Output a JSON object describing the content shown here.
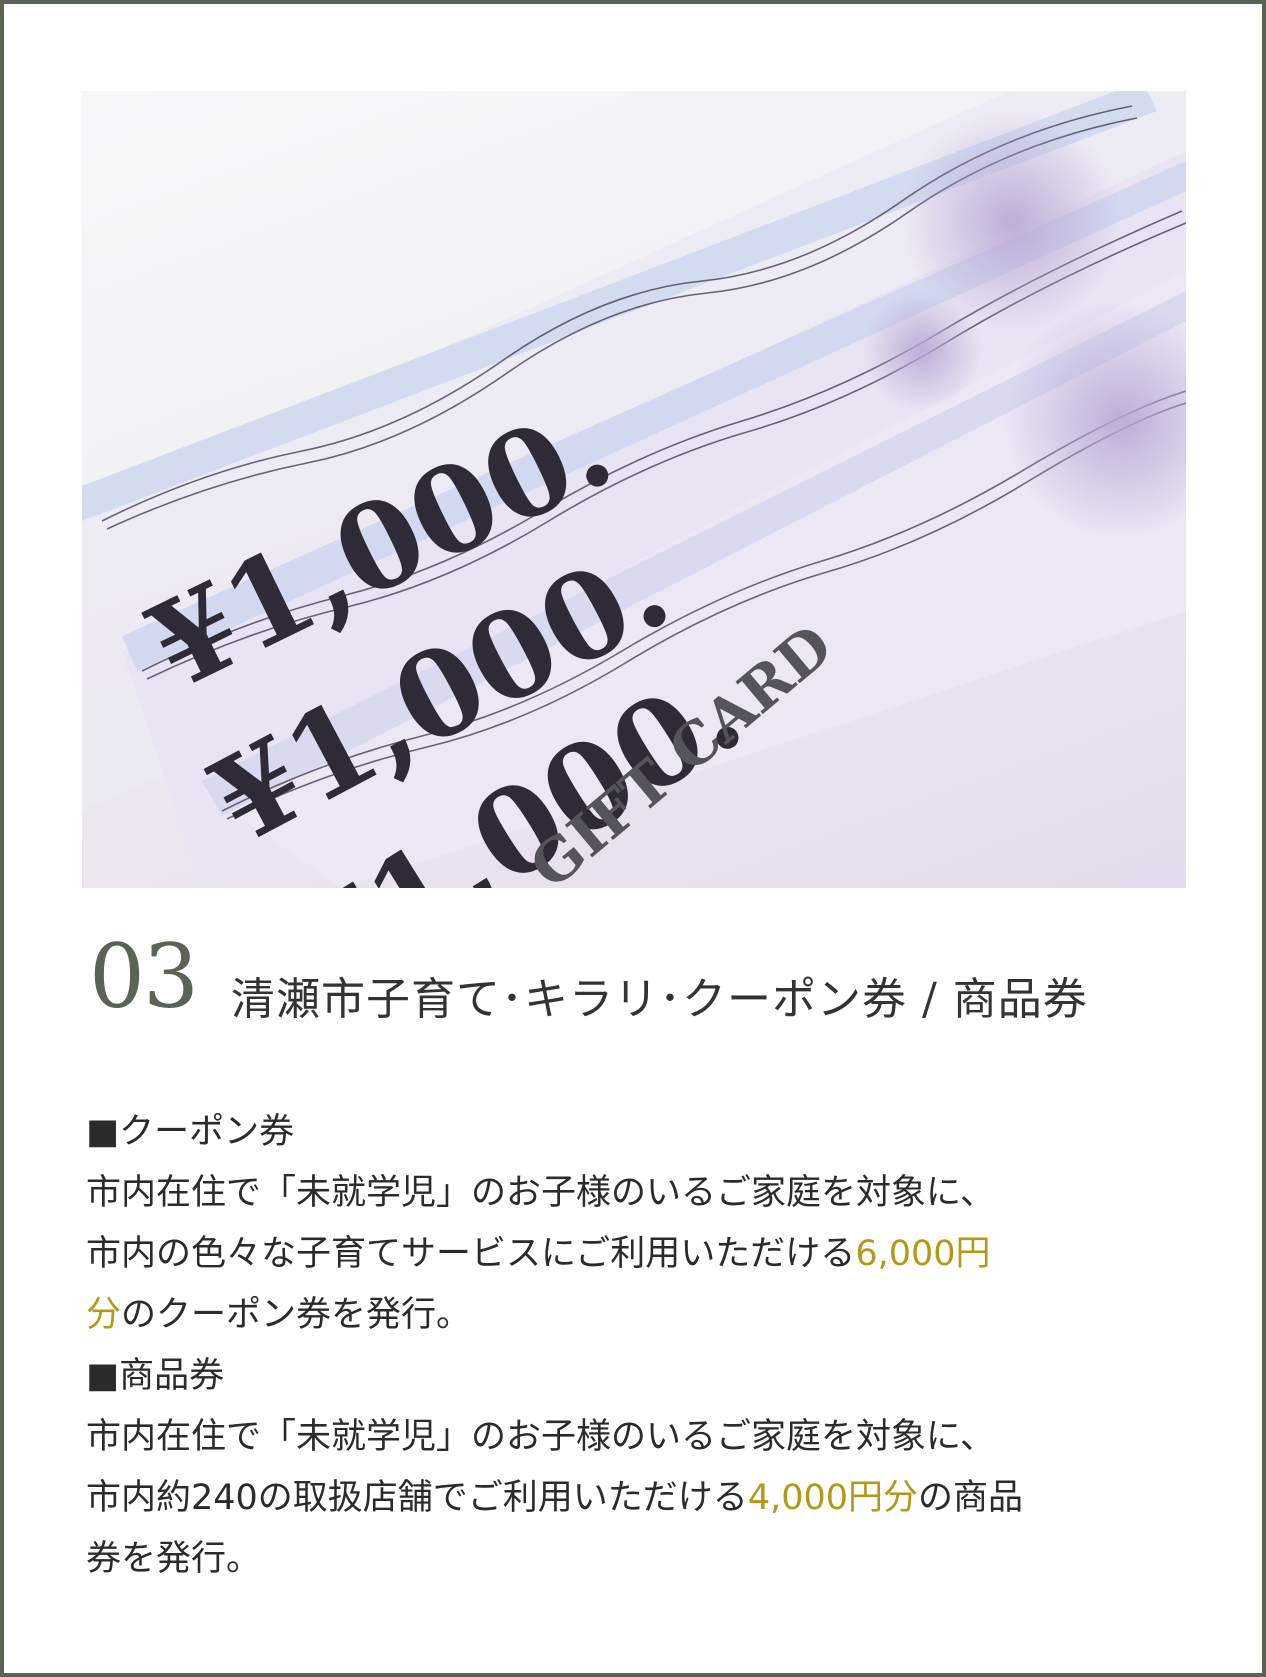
{
  "photo": {
    "alt_content": "gift card vouchers",
    "tickets": [
      {
        "amount": "¥1,000."
      },
      {
        "amount": "¥1,000."
      },
      {
        "amount": "¥1,000."
      }
    ],
    "card_label": "GIFT CARD"
  },
  "heading": {
    "number": "03",
    "title": "清瀬市子育て･キラリ･クーポン券 / 商品券"
  },
  "sections": {
    "coupon": {
      "header": "■クーポン券",
      "line1": "市内在住で「未就学児」のお子様のいるご家庭を対象に、",
      "line2_pre": "市内の色々な子育てサービスにご利用いただける",
      "line2_hl": "6,000円",
      "line3_hl": "分",
      "line3_post": "のクーポン券を発行。"
    },
    "goods": {
      "header": "■商品券",
      "line1": "市内在住で「未就学児」のお子様のいるご家庭を対象に、",
      "line2_pre": "市内約240の取扱店舗でご利用いただける",
      "line2_hl": "4,000円分",
      "line2_post": "の商品",
      "line3": "券を発行。"
    }
  },
  "colors": {
    "frame": "#5b6355",
    "highlight": "#b39a16",
    "text": "#2b2b2b"
  }
}
